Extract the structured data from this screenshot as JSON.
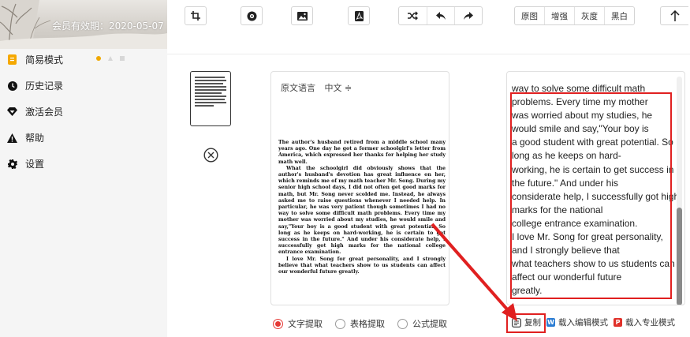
{
  "sidebar": {
    "membership": "会员有效期：2020-05-07",
    "items": [
      {
        "label": "简易模式",
        "icon": "document-icon",
        "active": true
      },
      {
        "label": "历史记录",
        "icon": "clock-icon"
      },
      {
        "label": "激活会员",
        "icon": "diamond-icon"
      },
      {
        "label": "帮助",
        "icon": "warning-icon"
      },
      {
        "label": "设置",
        "icon": "gear-icon"
      }
    ]
  },
  "toolbar": {
    "icons": [
      "crop-icon",
      "camera-icon",
      "image-icon",
      "pdf-icon",
      "shuffle-icon",
      "undo-icon",
      "redo-icon",
      "upload-icon"
    ],
    "filters": [
      "原图",
      "增强",
      "灰度",
      "黑白"
    ]
  },
  "source_panel": {
    "label": "原文语言",
    "language": "中文 ≑",
    "paragraphs": [
      "The author's husband retired from a middle school many years ago. One day he got a former schoolgirl's letter from America, which expressed her thanks for helping her study math well.",
      "What the schoolgirl did obviously shows that the author's husband's devotion has great influence on her, which reminds me of my math teacher Mr. Song. During my senior high school days, I did not often get good marks for math, but Mr. Song never scolded me. Instead, he always asked me to raise questions whenever I needed help. In particular, he was very patient though sometimes I had no way to solve some difficult math problems. Every time my mother was worried about my studies, he would smile and say,\"Your boy is a good student with great potential. So long as he keeps on hard-working, he is certain to get success in the future.\" And under his considerate help, I successfully got high marks for the national college entrance examination.",
      "I love Mr. Song for great personality, and I strongly believe that what teachers show to us students can affect our wonderful future greatly."
    ]
  },
  "result_panel": {
    "lines": [
      "way to solve some difficult math",
      "problems. Every time my mother",
      "was worried about my studies, he",
      "would smile and say,\"Your boy is",
      "a good student with great potential. So",
      "long as he keeps on hard-",
      "working, he is certain to get success in",
      "the future.\" And under his",
      "considerate help, I successfully got high",
      "marks for the national",
      "college entrance examination.",
      "I love Mr. Song for great personality,",
      "and I strongly believe that",
      "what teachers show to us students can",
      "affect our wonderful future",
      "greatly."
    ]
  },
  "options": {
    "modes": [
      {
        "label": "文字提取",
        "checked": true
      },
      {
        "label": "表格提取",
        "checked": false
      },
      {
        "label": "公式提取",
        "checked": false
      }
    ]
  },
  "actions": {
    "copy": "复制",
    "to_editor": "载入编辑模式",
    "to_pro": "载入专业模式"
  },
  "colors": {
    "accent": "#e53935",
    "highlight": "#e02020",
    "active_mode": "#f0a800",
    "word_blue": "#2b7cd3",
    "pro_red": "#e0312a"
  }
}
